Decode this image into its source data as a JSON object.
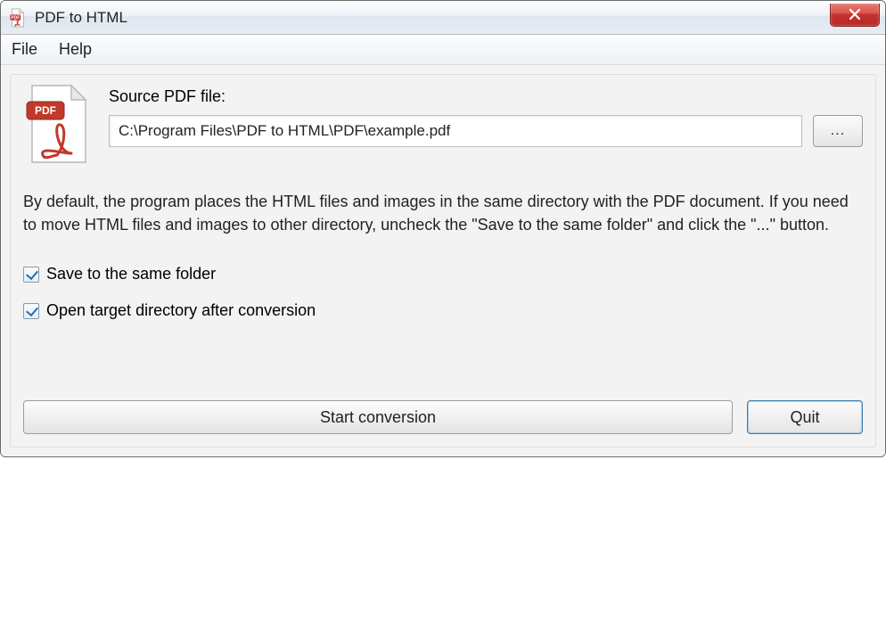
{
  "window": {
    "title": "PDF to HTML"
  },
  "menu": {
    "file": "File",
    "help": "Help"
  },
  "form": {
    "source_label": "Source PDF file:",
    "source_value": "C:\\Program Files\\PDF to HTML\\PDF\\example.pdf",
    "browse_label": "...",
    "description": "By default, the program places the HTML files and images in the same directory with the PDF document. If you need to move HTML files and images to other directory, uncheck the \"Save to the same folder\" and click the \"...\" button.",
    "cb_same_folder_label": "Save to the same folder",
    "cb_same_folder_checked": true,
    "cb_open_target_label": "Open target directory after conversion",
    "cb_open_target_checked": true
  },
  "buttons": {
    "start": "Start conversion",
    "quit": "Quit"
  }
}
